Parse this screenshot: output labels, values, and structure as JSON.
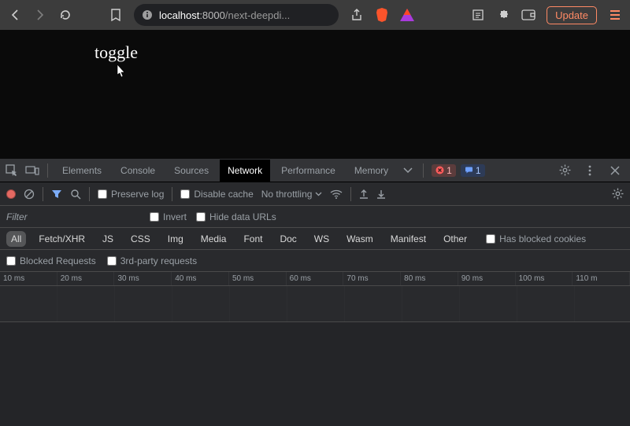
{
  "browser": {
    "url_host": "localhost",
    "url_port": ":8000",
    "url_path": "/next-deepdi...",
    "update_label": "Update"
  },
  "page": {
    "toggle_label": "toggle"
  },
  "devtools": {
    "tabs": [
      "Elements",
      "Console",
      "Sources",
      "Network",
      "Performance",
      "Memory"
    ],
    "active_tab": "Network",
    "error_count": "1",
    "info_count": "1",
    "toolbar": {
      "preserve_log": "Preserve log",
      "disable_cache": "Disable cache",
      "throttling": "No throttling"
    },
    "filter": {
      "placeholder": "Filter",
      "invert": "Invert",
      "hide_data_urls": "Hide data URLs"
    },
    "types": [
      "All",
      "Fetch/XHR",
      "JS",
      "CSS",
      "Img",
      "Media",
      "Font",
      "Doc",
      "WS",
      "Wasm",
      "Manifest",
      "Other"
    ],
    "types_active": "All",
    "has_blocked_cookies": "Has blocked cookies",
    "blocked_requests": "Blocked Requests",
    "third_party": "3rd-party requests",
    "timeline_ticks": [
      "10 ms",
      "20 ms",
      "30 ms",
      "40 ms",
      "50 ms",
      "60 ms",
      "70 ms",
      "80 ms",
      "90 ms",
      "100 ms",
      "110 m"
    ]
  }
}
